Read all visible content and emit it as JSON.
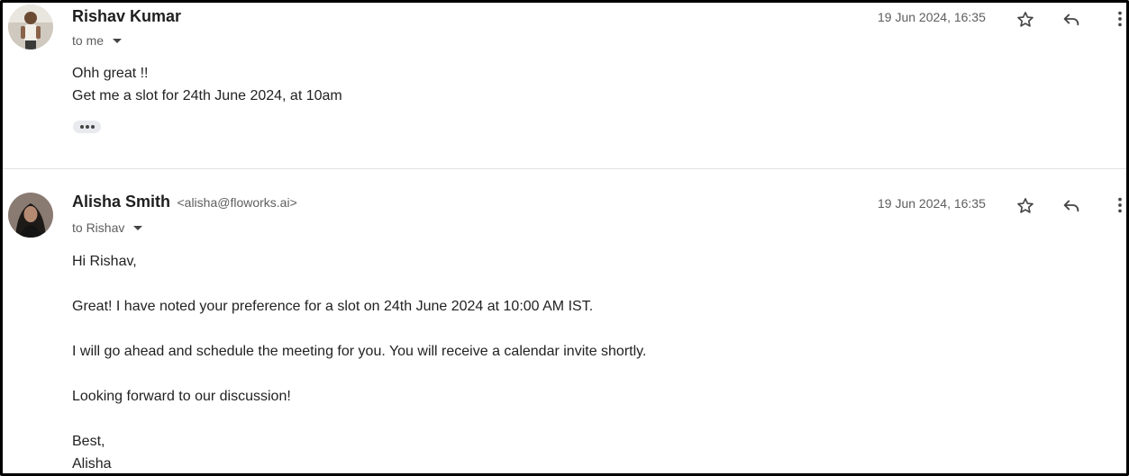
{
  "messages": [
    {
      "sender_name": "Rishav Kumar",
      "recipient": "to me",
      "timestamp": "19 Jun 2024, 16:35",
      "body": [
        "Ohh great !!",
        "Get me a slot for 24th June 2024, at 10am"
      ]
    },
    {
      "sender_name": "Alisha Smith",
      "sender_email": "<alisha@floworks.ai>",
      "recipient": "to Rishav",
      "timestamp": "19 Jun 2024, 16:35",
      "body": [
        "Hi Rishav,",
        "Great! I have noted your preference for a slot on 24th June 2024 at 10:00 AM IST.",
        "I will go ahead and schedule the meeting for you. You will receive a calendar invite shortly.",
        "Looking forward to our discussion!",
        "Best,",
        "Alisha"
      ]
    }
  ],
  "icons": {
    "star": "star-icon",
    "reply": "reply-icon",
    "more": "more-vert-icon",
    "caret": "caret-down-icon",
    "ellipsis": "show-trimmed-content-icon"
  },
  "colors": {
    "text_primary": "#1f1f1f",
    "text_secondary": "#5e5e5e",
    "divider": "#e3e3e3",
    "chip": "#e8eaed"
  }
}
